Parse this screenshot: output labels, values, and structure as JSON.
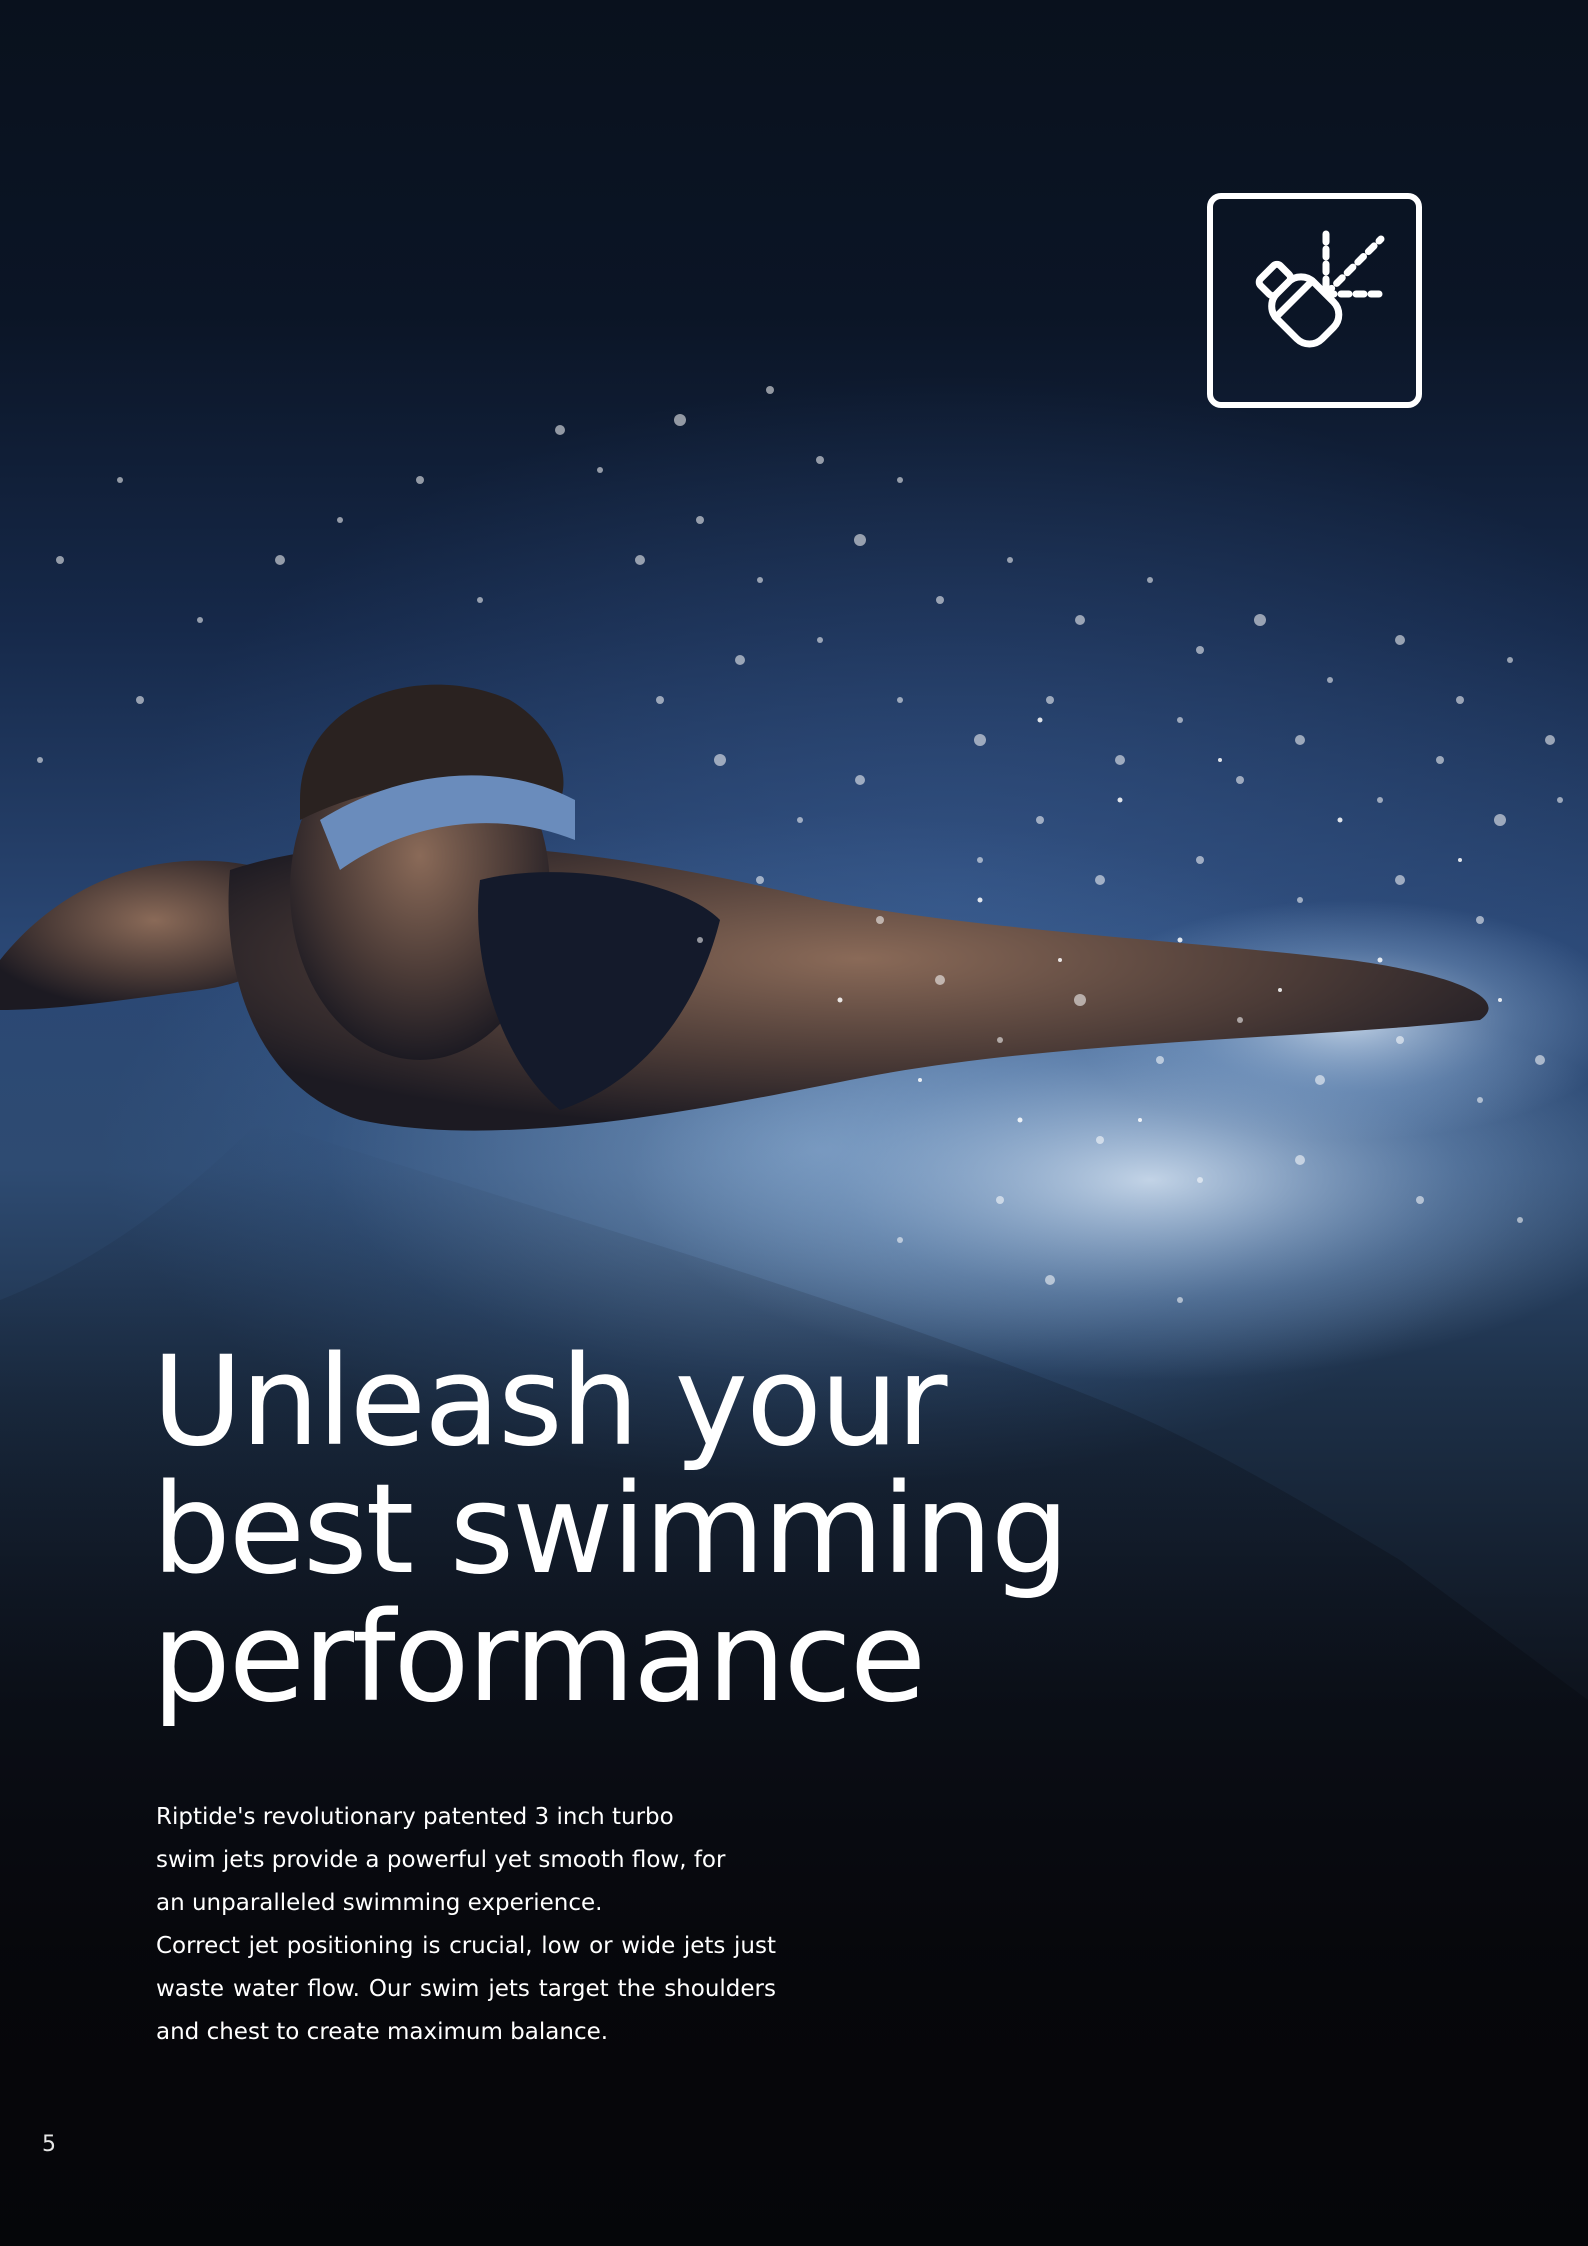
{
  "headline": {
    "line1": "Unleash your",
    "line2": "best swimming",
    "line3": "performance"
  },
  "body": {
    "paragraph1": "Riptide's revolutionary patented 3 inch turbo swim jets provide a powerful yet smooth flow, for an unparalleled swimming experience.",
    "paragraph2": "Correct jet positioning is crucial, low or wide jets just waste water flow. Our swim jets target the shoulders and chest to create maximum balance."
  },
  "page_number": "5",
  "icon": {
    "name": "swim-jet-icon"
  },
  "colors": {
    "text": "#ffffff",
    "background_top": "#09111d",
    "water_highlight": "#a0c3e6",
    "background_bottom": "#060304"
  }
}
